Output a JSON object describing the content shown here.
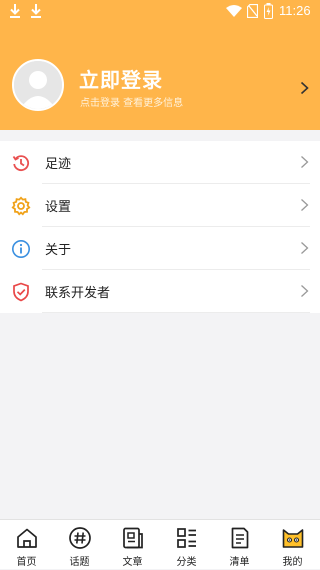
{
  "status_bar": {
    "time": "11:26",
    "icons": [
      "download-icon",
      "download-icon",
      "wifi-icon",
      "no-sim-icon",
      "battery-icon"
    ]
  },
  "profile": {
    "title": "立即登录",
    "subtitle": "点击登录 查看更多信息",
    "icons": [
      "avatar-placeholder",
      "chevron-right-icon"
    ]
  },
  "menu": {
    "items": [
      {
        "label": "足迹",
        "icon": "history-icon",
        "icon_color": "#e95050"
      },
      {
        "label": "设置",
        "icon": "gear-icon",
        "icon_color": "#f0a21a"
      },
      {
        "label": "关于",
        "icon": "info-icon",
        "icon_color": "#3a8fe0"
      },
      {
        "label": "联系开发者",
        "icon": "shield-check-icon",
        "icon_color": "#e94848"
      }
    ]
  },
  "tabbar": {
    "tabs": [
      {
        "label": "首页",
        "icon": "home-icon"
      },
      {
        "label": "话题",
        "icon": "hashtag-icon"
      },
      {
        "label": "文章",
        "icon": "article-icon"
      },
      {
        "label": "分类",
        "icon": "category-icon"
      },
      {
        "label": "清单",
        "icon": "list-icon"
      },
      {
        "label": "我的",
        "icon": "cat-face-icon",
        "active": true,
        "active_color": "#ffc02a"
      }
    ]
  },
  "colors": {
    "header_bg": "#ffb54a",
    "page_bg": "#f3f3f5"
  }
}
